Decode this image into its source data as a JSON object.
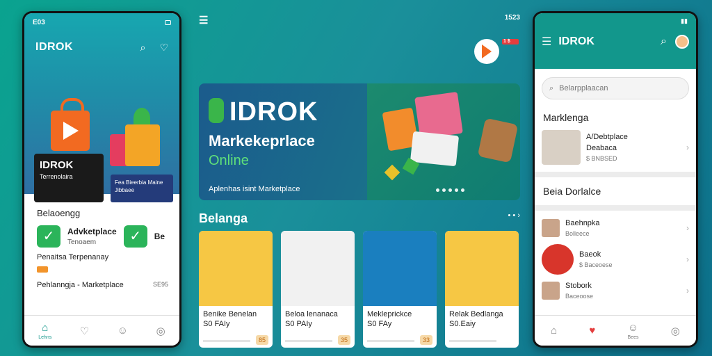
{
  "left": {
    "status": {
      "time": "E03"
    },
    "logo": "IDROK",
    "card": {
      "title": "IDROK",
      "sub": "Terrenolaira",
      "tag": ""
    },
    "card2": {
      "text": "Fea Bieerbia Maine Jibbaee"
    },
    "section": "Belaoengg",
    "item": {
      "title": "Advketplace",
      "sub": "Tenoaem",
      "title2": "Be"
    },
    "row": "Penaitsa   Terpenanay",
    "badge": "",
    "list_row": {
      "label": "Pehlanngja - Marketplace",
      "value": "SE95"
    },
    "nav": [
      {
        "label": "Lehns",
        "icon": "home-icon"
      },
      {
        "label": "",
        "icon": "heart-icon"
      },
      {
        "label": "",
        "icon": "smile-icon"
      },
      {
        "label": "",
        "icon": "user-icon"
      }
    ]
  },
  "center": {
    "status": {
      "time": "1523"
    },
    "badge_label": "1 $",
    "banner": {
      "logo": "IDROK",
      "sub": "Markekeprlace",
      "sub2": "Online",
      "caption": "Aplenhas isint Marketplace"
    },
    "section_title": "Belanga",
    "products": [
      {
        "name": "Benike Benelan",
        "price": "S0 FAIy",
        "badge": "85",
        "img_color": "#f6c744"
      },
      {
        "name": "Beloa lenanaca",
        "price": "S0 PAIy",
        "badge": "35",
        "img_color": "#f1f1f1"
      },
      {
        "name": "Mekleprickce",
        "price": "S0 FAy",
        "badge": "33",
        "img_color": "#1a7fbf"
      },
      {
        "name": "Relak Bedlanga",
        "price": "S0.Eaiy",
        "badge": "",
        "img_color": "#f6c744"
      }
    ]
  },
  "right": {
    "status": {
      "time": ""
    },
    "title": "IDROK",
    "search_placeholder": "Belarpplaacan",
    "section": "Marklenga",
    "row1": {
      "title": "A/Debtplace",
      "sub": "Deabaca",
      "small": "$ BNBSED"
    },
    "section2": "Beia Dorlalce",
    "row2": {
      "title": "Baehnpka",
      "small": "Bolleece"
    },
    "row3": {
      "title": "Baeok",
      "small": "$ Baceoese"
    },
    "row4": {
      "title": "Stobork",
      "small": "Baceoose"
    },
    "nav": [
      {
        "label": "",
        "icon": "home-icon"
      },
      {
        "label": "",
        "icon": "heart-icon"
      },
      {
        "label": "Bees",
        "icon": "smile-icon"
      },
      {
        "label": "",
        "icon": "user-icon"
      }
    ]
  }
}
